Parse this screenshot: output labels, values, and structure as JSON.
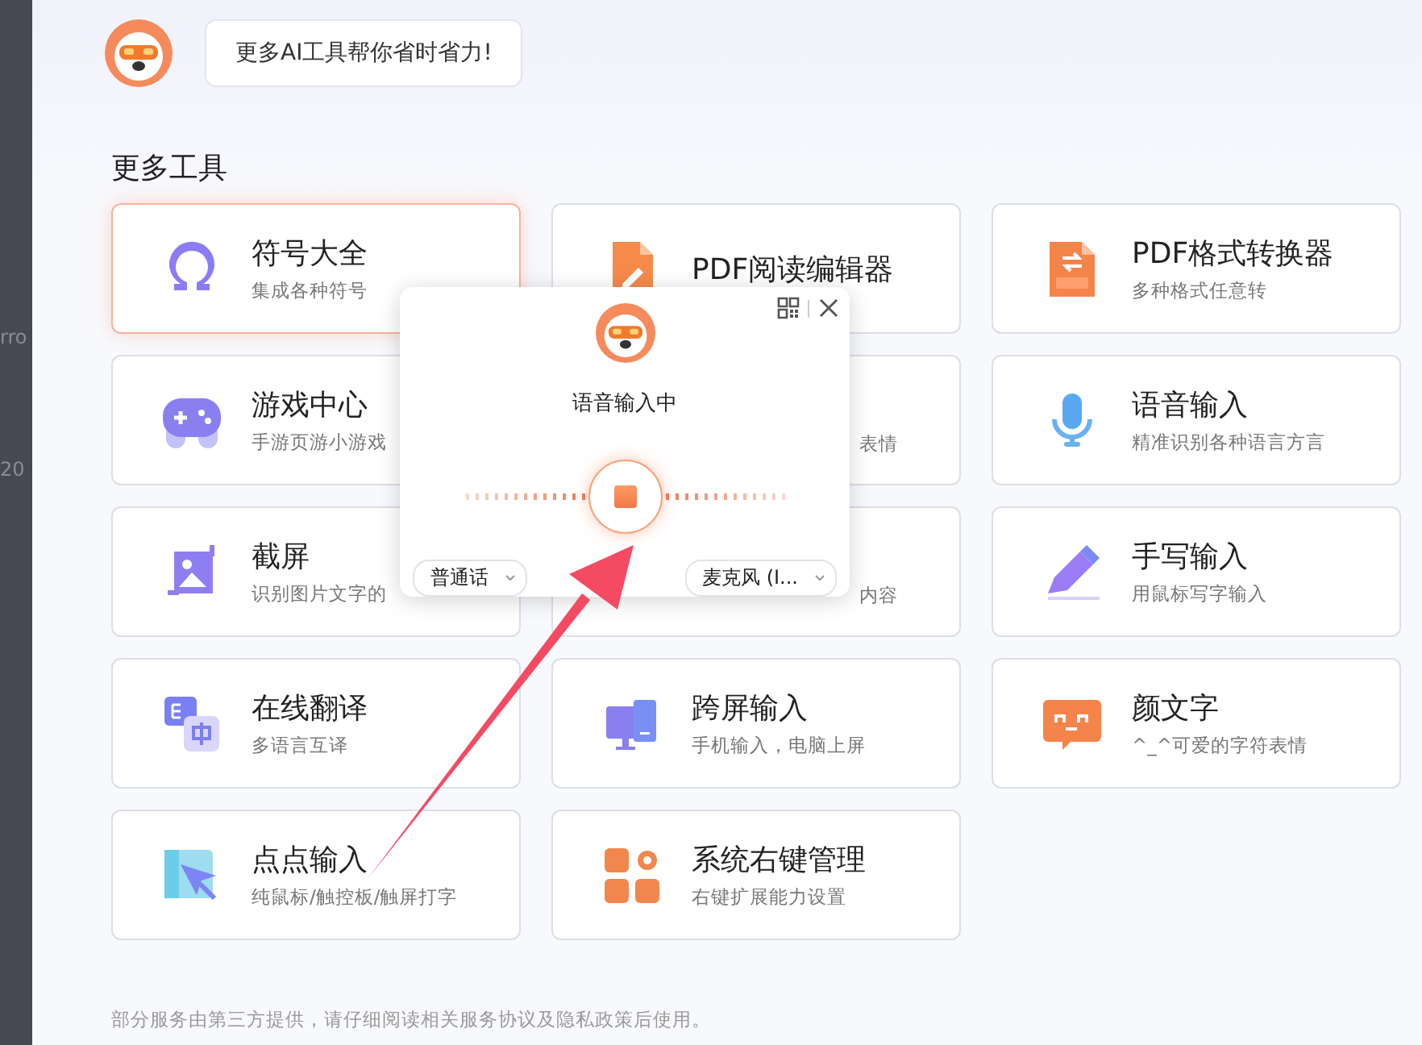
{
  "background_window": {
    "fragments": [
      "rro",
      "20"
    ]
  },
  "bubble": {
    "text": "更多AI工具帮你省时省力!"
  },
  "section_title": "更多工具",
  "tools": [
    {
      "title": "符号大全",
      "subtitle": "集成各种符号",
      "kind": "omega",
      "selected": true
    },
    {
      "title": "PDF阅读编辑器",
      "kind": "pdf-edit",
      "selected": false
    },
    {
      "title": "PDF格式转换器",
      "subtitle": "多种格式任意转",
      "kind": "pdf-convert",
      "selected": false
    },
    {
      "title": "游戏中心",
      "subtitle": "手游页游小游戏",
      "kind": "gamepad",
      "selected": false
    },
    {
      "subtitle": "表情",
      "kind": "covered",
      "selected": false
    },
    {
      "title": "语音输入",
      "subtitle": "精准识别各种语言方言",
      "kind": "mic",
      "selected": false
    },
    {
      "title": "截屏",
      "subtitle": "识别图片文字的",
      "kind": "screenshot",
      "selected": false
    },
    {
      "subtitle": "内容",
      "kind": "covered",
      "selected": false
    },
    {
      "title": "手写输入",
      "subtitle": "用鼠标写字输入",
      "kind": "pen",
      "selected": false
    },
    {
      "title": "在线翻译",
      "subtitle": "多语言互译",
      "kind": "translate",
      "selected": false
    },
    {
      "title": "跨屏输入",
      "subtitle": "手机输入，电脑上屏",
      "kind": "devices",
      "selected": false
    },
    {
      "title": "颜文字",
      "subtitle": "^_^可爱的字符表情",
      "kind": "emoticon",
      "selected": false
    },
    {
      "title": "点点输入",
      "subtitle": "纯鼠标/触控板/触屏打字",
      "kind": "cursor",
      "selected": false
    },
    {
      "title": "系统右键管理",
      "subtitle": "右键扩展能力设置",
      "kind": "apps",
      "selected": false
    }
  ],
  "voice_popup": {
    "status": "语音输入中",
    "recording": true,
    "language": "普通话",
    "microphone": "麦克风 (I..."
  },
  "footer": "部分服务由第三方提供，请仔细阅读相关服务协议及隐私政策后使用。"
}
